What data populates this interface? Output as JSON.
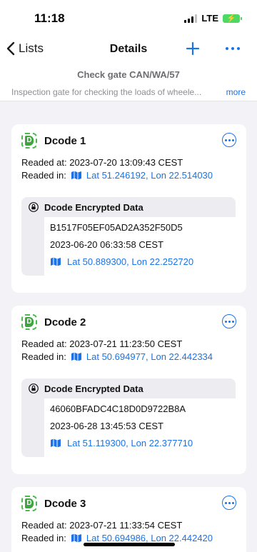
{
  "status": {
    "time": "11:18",
    "network": "LTE"
  },
  "nav": {
    "back_label": "Lists",
    "title": "Details"
  },
  "header": {
    "gate_name": "Check gate CAN/WA/57",
    "description": "Inspection gate for checking the loads of wheele...",
    "more_label": "more"
  },
  "labels": {
    "readed_at": "Readed at:",
    "readed_in": "Readed in:",
    "encrypted_title": "Dcode Encrypted Data"
  },
  "cards": [
    {
      "title": "Dcode 1",
      "readed_at": "2023-07-20 13:09:43 CEST",
      "readed_in": "Lat 51.246192, Lon 22.514030",
      "encrypted": {
        "code": "B1517F05EF05AD2A352F50D5",
        "date": "2023-06-20 06:33:58 CEST",
        "location": "Lat 50.889300, Lon 22.252720"
      }
    },
    {
      "title": "Dcode 2",
      "readed_at": "2023-07-21 11:23:50 CEST",
      "readed_in": "Lat 50.694977, Lon 22.442334",
      "encrypted": {
        "code": "46060BFADC4C18D0D9722B8A",
        "date": "2023-06-28 13:45:53 CEST",
        "location": "Lat 51.119300, Lon 22.377710"
      }
    },
    {
      "title": "Dcode 3",
      "readed_at": "2023-07-21 11:33:54 CEST",
      "readed_in": "Lat 50.694986, Lon 22.442420"
    }
  ],
  "icons": {
    "back": "chevron-left-icon",
    "add": "plus-icon",
    "more": "ellipsis-icon",
    "logo": "dcode-logo-icon",
    "card_menu": "ellipsis-circle-icon",
    "map": "map-icon",
    "lock": "lock-icon"
  },
  "colors": {
    "accent": "#1a73e8",
    "background": "#f2f2f7",
    "card": "#ffffff",
    "encrypted_header": "#ececf1",
    "logo_green": "#3fa63f"
  }
}
